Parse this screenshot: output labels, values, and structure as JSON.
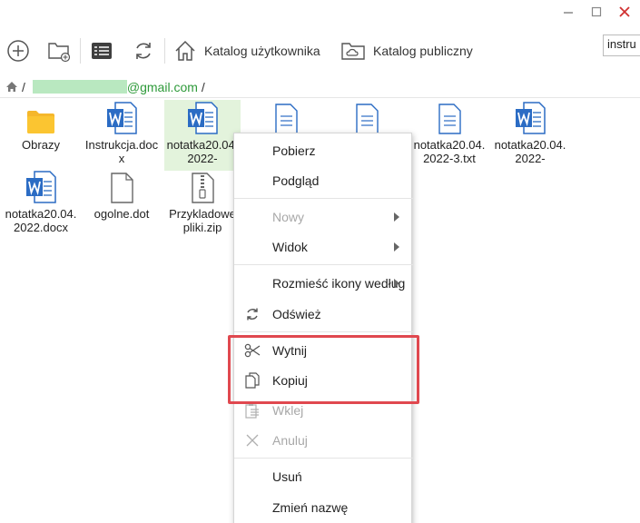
{
  "window": {
    "minimize_icon": "minimize-icon",
    "maximize_icon": "maximize-icon",
    "close_icon": "close-icon",
    "close_color": "#d03030"
  },
  "toolbar": {
    "user_catalog_label": "Katalog użytkownika",
    "public_catalog_label": "Katalog publiczny"
  },
  "search": {
    "value": "instru"
  },
  "path": {
    "root": "/",
    "email_suffix": "@gmail.com",
    "trailing": "/"
  },
  "files": [
    {
      "name": "Obrazy",
      "type": "folder"
    },
    {
      "name": "Instrukcja.docx",
      "type": "word"
    },
    {
      "name": "notatka20.04.2022-",
      "type": "word"
    },
    {
      "name": "",
      "type": "text"
    },
    {
      "name": "",
      "type": "text"
    },
    {
      "name": "notatka20.04.2022-3.txt",
      "type": "text"
    },
    {
      "name": "notatka20.04.2022-",
      "type": "word"
    },
    {
      "name": "notatka20.04.2022.docx",
      "type": "word"
    },
    {
      "name": "ogolne.dot",
      "type": "blank"
    },
    {
      "name": "Przykladowe pliki.zip",
      "type": "zip"
    }
  ],
  "context_menu": {
    "download": "Pobierz",
    "preview": "Podgląd",
    "new": "Nowy",
    "view": "Widok",
    "arrange": "Rozmieść ikony według",
    "refresh": "Odśwież",
    "cut": "Wytnij",
    "copy": "Kopiuj",
    "paste": "Wklej",
    "cancel": "Anuluj",
    "delete": "Usuń",
    "rename": "Zmień nazwę"
  },
  "colors": {
    "accent_green": "#2e9a3a",
    "selection_bg": "#e3f3dc",
    "highlight_red": "#e0484f",
    "word_blue": "#2b6cc4"
  }
}
